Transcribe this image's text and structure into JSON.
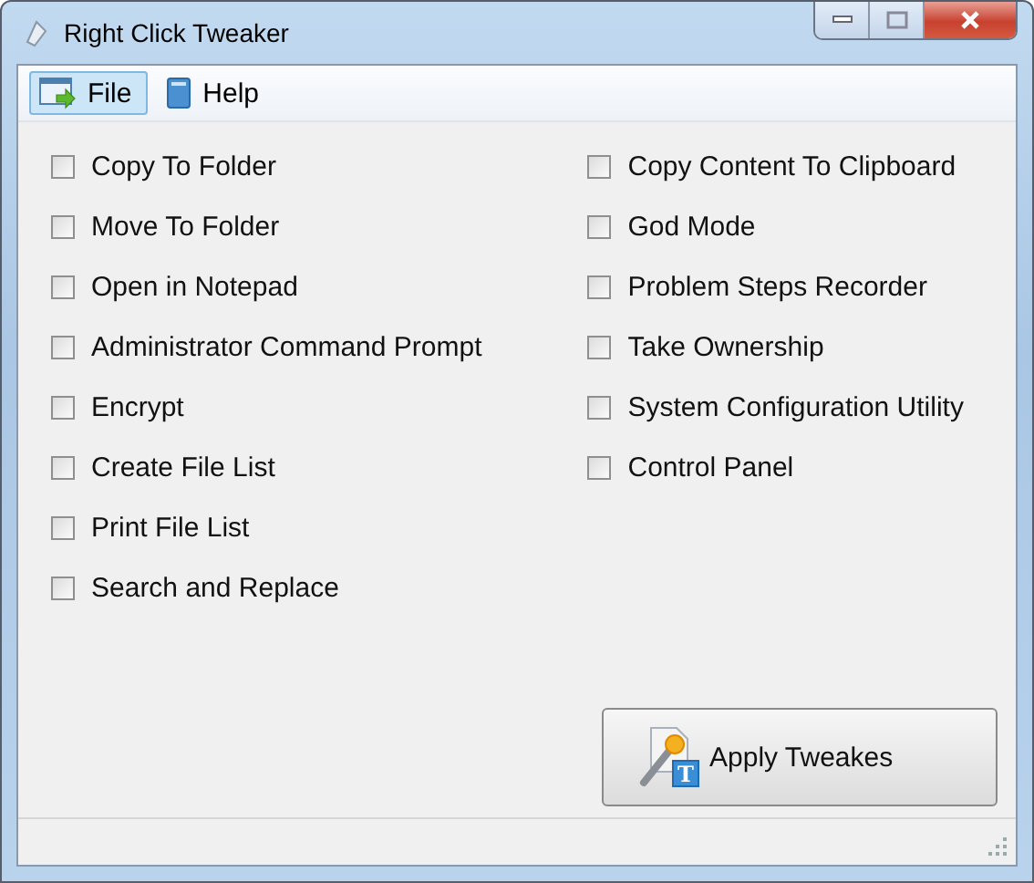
{
  "window": {
    "title": "Right Click Tweaker"
  },
  "menu": [
    {
      "label": "File",
      "selected": true,
      "kind": "file"
    },
    {
      "label": "Help",
      "selected": false,
      "kind": "help"
    }
  ],
  "options_left": [
    {
      "label": "Copy To Folder",
      "checked": false
    },
    {
      "label": "Move To Folder",
      "checked": false
    },
    {
      "label": "Open in Notepad",
      "checked": false
    },
    {
      "label": "Administrator Command Prompt",
      "checked": false
    },
    {
      "label": "Encrypt",
      "checked": false
    },
    {
      "label": "Create File List",
      "checked": false
    },
    {
      "label": "Print File List",
      "checked": false
    },
    {
      "label": "Search and Replace",
      "checked": false
    }
  ],
  "options_right": [
    {
      "label": "Copy Content To Clipboard",
      "checked": false
    },
    {
      "label": "God Mode",
      "checked": false
    },
    {
      "label": "Problem Steps Recorder",
      "checked": false
    },
    {
      "label": "Take Ownership",
      "checked": false
    },
    {
      "label": "System Configuration Utility",
      "checked": false
    },
    {
      "label": "Control Panel",
      "checked": false
    }
  ],
  "apply_button": {
    "label": "Apply Tweakes",
    "icon_letter": "T"
  }
}
